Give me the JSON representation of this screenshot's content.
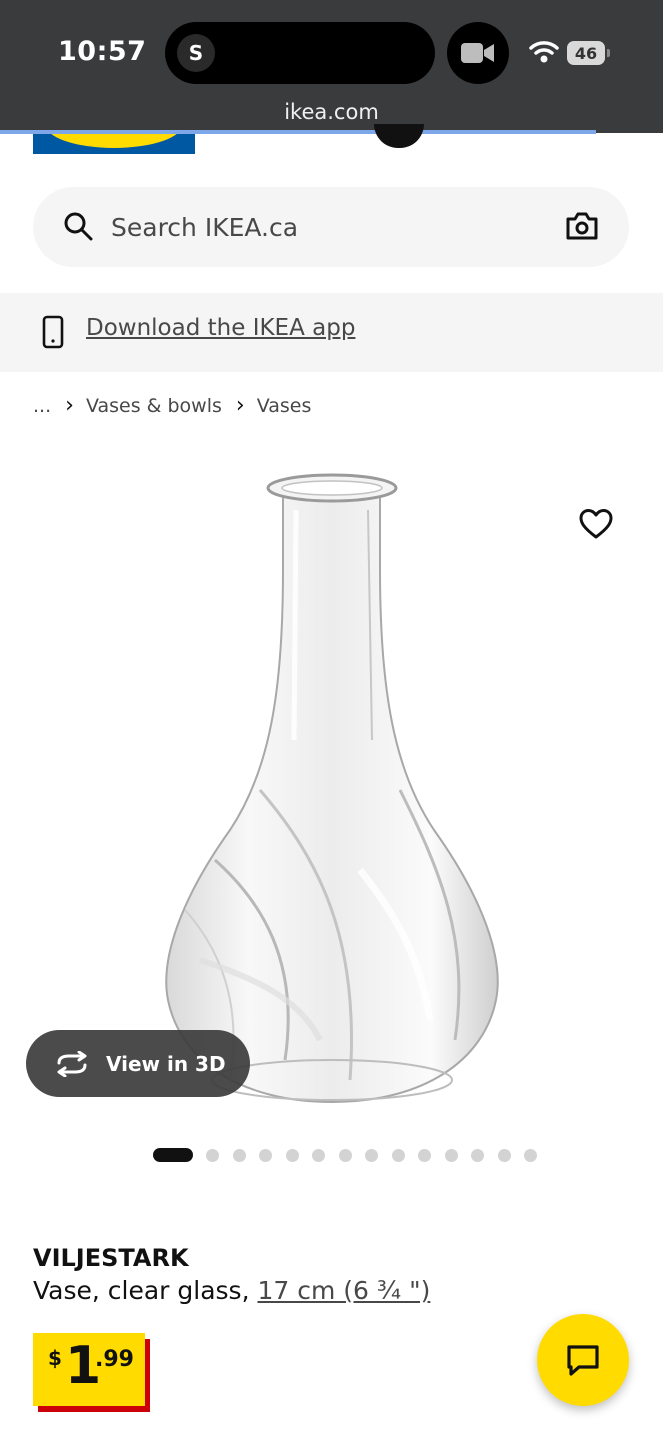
{
  "status_bar": {
    "time": "10:57",
    "island_avatar": "S",
    "battery": "46",
    "url": "ikea.com"
  },
  "search": {
    "placeholder": "Search IKEA.ca"
  },
  "app_banner": {
    "link": "Download the IKEA app"
  },
  "breadcrumb": {
    "items": [
      "...",
      "Vases & bowls",
      "Vases"
    ]
  },
  "gallery": {
    "view_3d_label": "View in 3D",
    "image_count": 14,
    "active_index": 0
  },
  "product": {
    "name": "VILJESTARK",
    "description": "Vase, clear glass, ",
    "size": "17 cm (6 ¾ \")",
    "price": {
      "currency": "$",
      "integer": "1",
      "decimal": ".99"
    }
  },
  "colors": {
    "brand_yellow": "#ffdb00",
    "brand_blue": "#0058a3",
    "price_red": "#cc0008"
  },
  "icons": [
    "search-icon",
    "camera-icon",
    "phone-icon",
    "heart-icon",
    "rotate-3d-icon",
    "chat-icon",
    "video-camera-icon",
    "wifi-icon"
  ]
}
